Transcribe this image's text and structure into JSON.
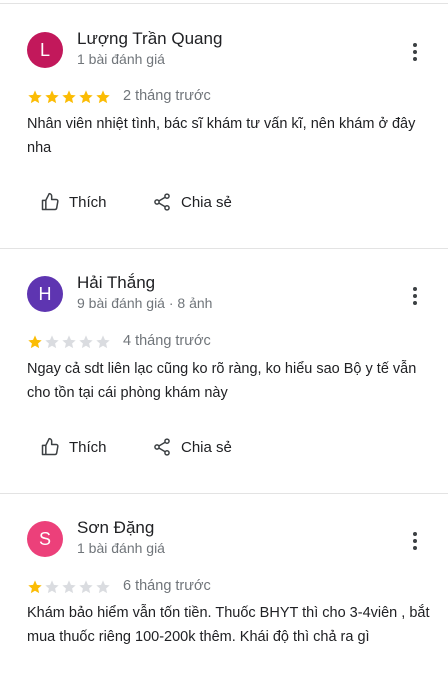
{
  "reviews": [
    {
      "initial": "L",
      "avatar_color": "#c2185b",
      "name": "Lượng Trần Quang",
      "meta": "1 bài đánh giá",
      "rating": 5,
      "time": "2 tháng trước",
      "text": "Nhân viên nhiệt tình, bác sĩ khám tư vấn kĩ, nên khám ở đây nha",
      "like_label": "Thích",
      "share_label": "Chia sẻ"
    },
    {
      "initial": "H",
      "avatar_color": "#5e35b1",
      "name": "Hải Thắng",
      "meta": "9 bài đánh giá · 8 ảnh",
      "rating": 1,
      "time": "4 tháng trước",
      "text": "Ngay cả sdt liên lạc cũng ko rõ ràng, ko hiểu sao Bộ y tế vẫn cho tồn tại cái phòng khám này",
      "like_label": "Thích",
      "share_label": "Chia sẻ"
    },
    {
      "initial": "S",
      "avatar_color": "#ec407a",
      "name": "Sơn Đặng",
      "meta": "1 bài đánh giá",
      "rating": 1,
      "time": "6 tháng trước",
      "text": "Khám bảo hiểm vẫn tốn tiền. Thuốc BHYT thì cho 3-4viên , bắt mua thuốc riêng 100-200k thêm. Khái độ thì chả ra gì"
    }
  ],
  "colors": {
    "star_filled": "#fbbc04",
    "star_empty": "#dadce0"
  }
}
